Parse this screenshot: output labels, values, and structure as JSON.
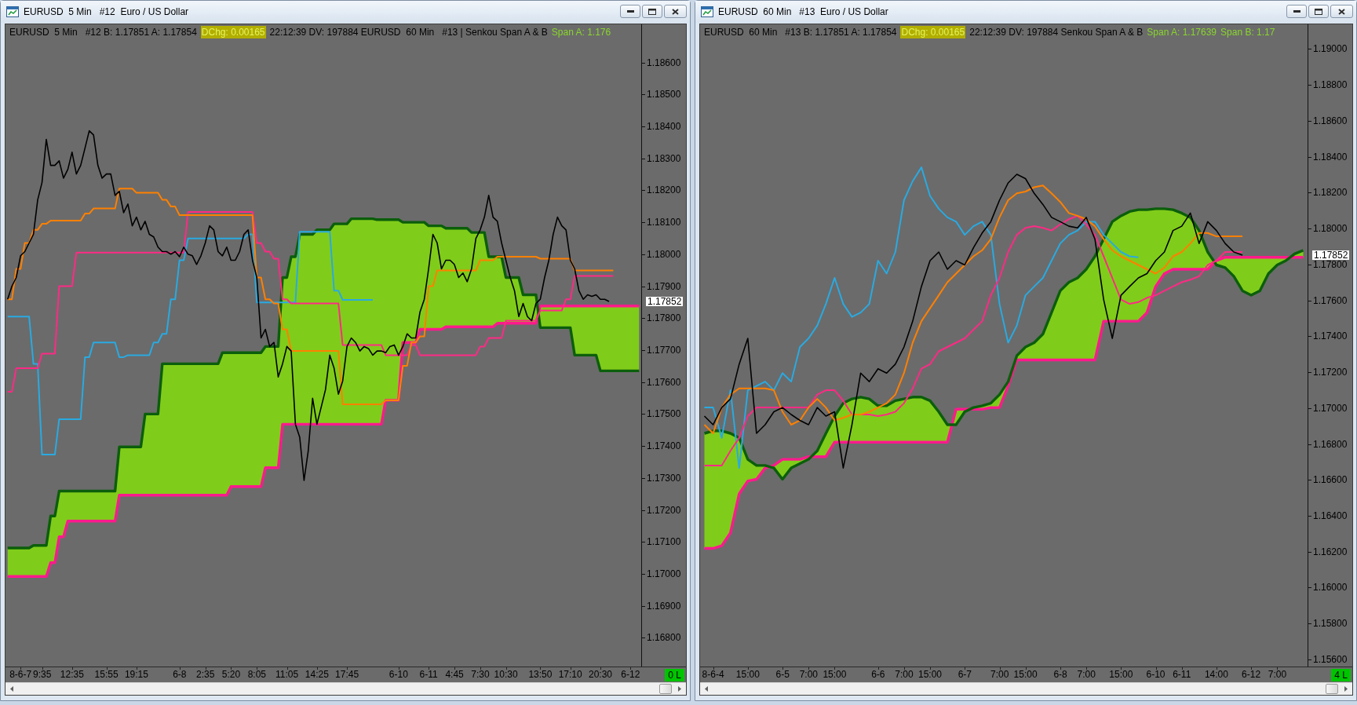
{
  "windows": [
    {
      "title": "EURUSD  5 Min   #12  Euro / US Dollar",
      "header": [
        {
          "kind": "text",
          "text": "EURUSD  5 Min   #12 B: 1.17851 A: 1.17854"
        },
        {
          "kind": "change",
          "text": "DChg: 0.00165"
        },
        {
          "kind": "text",
          "text": "22:12:39 DV: 197884 EURUSD  60 Min   #13 | Senkou Span A & B"
        },
        {
          "kind": "study-value",
          "text": "Span A: 1.176"
        }
      ],
      "bar_status": "0 L",
      "chart_data": {
        "type": "line",
        "categories": [
          null,
          null,
          null,
          "8-6-7",
          null,
          null,
          null,
          null,
          "9:35",
          null,
          null,
          null,
          null,
          null,
          null,
          "12:35",
          null,
          null,
          null,
          null,
          null,
          null,
          null,
          "15:55",
          null,
          null,
          null,
          null,
          null,
          null,
          "19:15",
          null,
          null,
          null,
          null,
          null,
          null,
          null,
          null,
          null,
          "6-8",
          null,
          null,
          null,
          null,
          null,
          "2:35",
          null,
          null,
          null,
          null,
          null,
          "5:20",
          null,
          null,
          null,
          null,
          null,
          "8:05",
          null,
          null,
          null,
          null,
          null,
          null,
          "11:05",
          null,
          null,
          null,
          null,
          null,
          null,
          "14:25",
          null,
          null,
          null,
          null,
          null,
          null,
          "17:45",
          null,
          null,
          null,
          null,
          null,
          null,
          null,
          null,
          null,
          null,
          null,
          "6-10",
          null,
          null,
          null,
          null,
          null,
          null,
          "6-11",
          null,
          null,
          null,
          null,
          null,
          "4:45",
          null,
          null,
          null,
          null,
          null,
          "7:30",
          null,
          null,
          null,
          null,
          null,
          "10:30",
          null,
          null,
          null,
          null,
          null,
          null,
          null,
          "13:50",
          null,
          null,
          null,
          null,
          null,
          null,
          "17:10",
          null,
          null,
          null,
          null,
          null,
          null,
          "20:30",
          null,
          null,
          null,
          null,
          null,
          null,
          "6-12",
          null,
          null
        ],
        "ylim": [
          1.1671,
          1.1867
        ],
        "yticks": [
          {
            "value": 1.186,
            "label": "1.18600"
          },
          {
            "value": 1.185,
            "label": "1.18500"
          },
          {
            "value": 1.184,
            "label": "1.18400"
          },
          {
            "value": 1.183,
            "label": "1.18300"
          },
          {
            "value": 1.182,
            "label": "1.18200"
          },
          {
            "value": 1.181,
            "label": "1.18100"
          },
          {
            "value": 1.18,
            "label": "1.18000"
          },
          {
            "value": 1.179,
            "label": "1.17900"
          },
          {
            "value": 1.178,
            "label": "1.17800"
          },
          {
            "value": 1.177,
            "label": "1.17700"
          },
          {
            "value": 1.176,
            "label": "1.17600"
          },
          {
            "value": 1.175,
            "label": "1.17500"
          },
          {
            "value": 1.174,
            "label": "1.17400"
          },
          {
            "value": 1.173,
            "label": "1.17300"
          },
          {
            "value": 1.172,
            "label": "1.17200"
          },
          {
            "value": 1.171,
            "label": "1.17100"
          },
          {
            "value": 1.17,
            "label": "1.17000"
          },
          {
            "value": 1.169,
            "label": "1.16900"
          },
          {
            "value": 1.168,
            "label": "1.16800"
          }
        ],
        "annotations": [
          "1.17852"
        ],
        "series": [
          {
            "color": "#000000",
            "values": [
              1.17859,
              1.179,
              1.17927,
              1.17995,
              1.18008,
              1.18035,
              1.18062,
              1.1817,
              1.18224,
              1.18359,
              1.18278,
              1.18278,
              1.18292,
              1.18238,
              1.18265,
              1.18319,
              1.18251,
              1.18278,
              1.18332,
              1.18386,
              1.18373,
              1.18278,
              1.18238,
              1.18251,
              1.18251,
              1.18184,
              1.18197,
              1.1813,
              1.18157,
              1.18089,
              1.18116,
              1.18076,
              1.18103,
              1.18062,
              1.18054,
              1.18022,
              1.18008,
              1.18008,
              1.18,
              1.18008,
              1.17992,
              1.18022,
              1.18,
              1.17995,
              1.17968,
              1.17995,
              1.18035,
              1.18089,
              1.18076,
              1.18008,
              1.17995,
              1.18022,
              1.17981,
              1.17981,
              1.18008,
              1.18062,
              1.18076,
              1.17981,
              1.17927,
              1.17738,
              1.17765,
              1.17711,
              1.17724,
              1.17616,
              1.17657,
              1.17711,
              1.17697,
              1.17468,
              1.17427,
              1.17292,
              1.17386,
              1.17549,
              1.17468,
              1.17522,
              1.17576,
              1.17684,
              1.17643,
              1.17562,
              1.17603,
              1.17711,
              1.17738,
              1.17724,
              1.17697,
              1.17711,
              1.17705,
              1.17684,
              1.17697,
              1.17697,
              1.17692,
              1.17711,
              1.17716,
              1.17684,
              1.17711,
              1.17751,
              1.17738,
              1.17738,
              1.17819,
              1.17859,
              1.17954,
              1.18062,
              1.18035,
              1.17954,
              1.17981,
              1.17981,
              1.17968,
              1.17927,
              1.17941,
              1.17914,
              1.17954,
              1.18049,
              1.18076,
              1.18116,
              1.18184,
              1.18116,
              1.18103,
              1.18035,
              1.17981,
              1.17927,
              1.17886,
              1.17805,
              1.17846,
              1.17805,
              1.17792,
              1.17846,
              1.17859,
              1.17927,
              1.17981,
              1.18062,
              1.18116,
              1.18089,
              1.18076,
              1.17981,
              1.17954,
              1.17886,
              1.17859,
              1.17873,
              1.17868,
              1.17873,
              1.17859,
              1.17859,
              1.17852,
              null,
              null,
              null,
              null,
              null,
              null,
              null
            ]
          },
          {
            "color": "#ff8000",
            "values": [
              1.17859,
              1.17859,
              1.17954,
              1.17954,
              1.18035,
              1.18035,
              1.18076,
              1.18076,
              1.18095,
              1.18095,
              1.18105,
              1.18105,
              1.18105,
              1.18105,
              1.18105,
              1.18105,
              1.18105,
              1.18105,
              1.18127,
              1.18127,
              1.18143,
              1.18143,
              1.18143,
              1.18143,
              1.18143,
              1.18143,
              1.18205,
              1.18205,
              1.18205,
              1.18205,
              1.18192,
              1.18192,
              1.18192,
              1.18192,
              1.18192,
              1.18192,
              1.1817,
              1.1817,
              1.18149,
              1.18149,
              1.18122,
              1.18122,
              1.18122,
              1.18122,
              1.18122,
              1.18122,
              1.18122,
              1.18122,
              1.18122,
              1.18122,
              1.18122,
              1.18122,
              1.18122,
              1.18122,
              1.18122,
              1.18122,
              1.18122,
              1.18122,
              1.17927,
              1.17927,
              1.17859,
              1.17859,
              1.17846,
              1.17846,
              1.17765,
              1.17765,
              1.17697,
              1.17697,
              1.17697,
              1.17697,
              1.17697,
              1.17697,
              1.17697,
              1.17697,
              1.17697,
              1.17697,
              1.17697,
              1.17697,
              1.1753,
              1.1753,
              1.1753,
              1.1753,
              1.1753,
              1.1753,
              1.1753,
              1.1753,
              1.1753,
              1.1753,
              1.17543,
              1.17543,
              1.17543,
              1.17543,
              1.17651,
              1.17651,
              1.17724,
              1.17724,
              1.17743,
              1.17743,
              1.179,
              1.179,
              1.17949,
              1.17949,
              1.17949,
              1.17949,
              1.17949,
              1.17949,
              1.17949,
              1.17949,
              1.17949,
              1.17949,
              1.17981,
              1.17981,
              1.17981,
              1.17981,
              1.17992,
              1.17992,
              1.17992,
              1.17992,
              1.17992,
              1.17992,
              1.17992,
              1.17992,
              1.17992,
              1.17992,
              1.17986,
              1.17986,
              1.17986,
              1.17986,
              1.17986,
              1.17986,
              1.17986,
              1.17986,
              1.17949,
              1.17949,
              1.17949,
              1.17949,
              1.17949,
              1.17949,
              1.17949,
              1.17949,
              1.17949,
              1.17949,
              null,
              null,
              null,
              null,
              null,
              null
            ]
          },
          {
            "color": "#ff2a85",
            "values": [
              1.1757,
              1.1757,
              1.17643,
              1.17643,
              1.17643,
              1.17643,
              1.17643,
              1.17643,
              1.17689,
              1.17689,
              1.17689,
              1.17689,
              1.179,
              1.179,
              1.179,
              1.179,
              1.18005,
              1.18005,
              1.18005,
              1.18005,
              1.18005,
              1.18005,
              1.18005,
              1.18005,
              1.18005,
              1.18005,
              1.18005,
              1.18005,
              1.18005,
              1.18005,
              1.18005,
              1.18005,
              1.18005,
              1.18005,
              1.18005,
              1.18005,
              1.18005,
              1.18005,
              1.18005,
              1.18005,
              1.18005,
              1.18005,
              1.18132,
              1.18132,
              1.18132,
              1.18132,
              1.18132,
              1.18132,
              1.18132,
              1.18132,
              1.18132,
              1.18132,
              1.18132,
              1.18132,
              1.18132,
              1.18132,
              1.18132,
              1.18132,
              1.18035,
              1.18035,
              1.18008,
              1.18008,
              1.17986,
              1.17986,
              1.17859,
              1.17859,
              1.17846,
              1.17846,
              1.17846,
              1.17846,
              1.17846,
              1.17846,
              1.17846,
              1.17846,
              1.17846,
              1.17846,
              1.17846,
              1.17846,
              1.17716,
              1.17716,
              1.17716,
              1.17716,
              1.17716,
              1.17716,
              1.17716,
              1.17716,
              1.17716,
              1.17716,
              1.17684,
              1.17684,
              1.17684,
              1.17684,
              1.17684,
              1.17684,
              1.17716,
              1.17716,
              1.17684,
              1.17684,
              1.17684,
              1.17684,
              1.17684,
              1.17684,
              1.17684,
              1.17684,
              1.17684,
              1.17684,
              1.17684,
              1.17684,
              1.17684,
              1.17684,
              1.17711,
              1.17711,
              1.17738,
              1.17738,
              1.17738,
              1.17738,
              1.17792,
              1.17792,
              1.17792,
              1.17792,
              1.17792,
              1.17792,
              1.17792,
              1.17792,
              1.17824,
              1.17824,
              1.17824,
              1.17824,
              1.17824,
              1.17824,
              1.17859,
              1.17859,
              1.17932,
              1.17932,
              1.17932,
              1.17932,
              1.17932,
              1.17932,
              1.17932,
              1.17932,
              1.17932,
              1.17932,
              null,
              null,
              null,
              null,
              null,
              null
            ]
          },
          {
            "color": "#29aae1",
            "values": [
              1.17805,
              1.17805,
              1.17805,
              1.17805,
              1.17805,
              1.17805,
              1.17657,
              1.17657,
              1.17373,
              1.17373,
              1.17373,
              1.17373,
              1.17484,
              1.17484,
              1.17484,
              1.17484,
              1.17484,
              1.17484,
              1.17678,
              1.17678,
              1.17724,
              1.17724,
              1.17724,
              1.17724,
              1.17724,
              1.17724,
              1.17678,
              1.17678,
              1.17684,
              1.17684,
              1.17684,
              1.17684,
              1.17684,
              1.17684,
              1.17724,
              1.17724,
              1.17751,
              1.17751,
              1.17859,
              1.17859,
              1.17981,
              1.17981,
              1.18049,
              1.18049,
              1.18049,
              1.18049,
              1.18049,
              1.18049,
              1.18049,
              1.18049,
              1.18049,
              1.18049,
              1.18049,
              1.18049,
              1.18049,
              1.18049,
              1.18062,
              1.18062,
              1.17849,
              1.17849,
              1.17849,
              1.17849,
              1.17849,
              1.17849,
              1.17849,
              1.17849,
              1.17849,
              1.17849,
              1.1807,
              1.1807,
              1.1807,
              1.1807,
              1.1807,
              1.1807,
              1.1807,
              1.1807,
              1.17886,
              1.17886,
              1.17857,
              1.17857,
              1.17857,
              1.17857,
              1.17857,
              1.17857,
              1.17857,
              1.17857,
              null,
              null,
              null,
              null,
              null,
              null,
              null,
              null,
              null,
              null,
              null,
              null,
              null,
              null,
              null,
              null,
              null,
              null,
              null,
              null,
              null,
              null,
              null,
              null,
              null,
              null,
              null,
              null,
              null,
              null,
              null,
              null,
              null,
              null,
              null,
              null,
              null,
              null,
              null,
              null,
              null,
              null,
              null,
              null,
              null,
              null,
              null,
              null,
              null,
              null,
              null,
              null,
              null,
              null,
              null,
              null,
              null,
              null,
              null,
              null,
              null,
              null
            ]
          },
          {
            "color": "#0b5e0b",
            "values": [
              1.17081,
              1.17081,
              1.17081,
              1.17081,
              1.17081,
              1.17081,
              1.17089,
              1.17089,
              1.17089,
              1.17089,
              1.17181,
              1.17181,
              1.17259,
              1.17259,
              1.17259,
              1.17259,
              1.17259,
              1.17259,
              1.17259,
              1.17259,
              1.17259,
              1.17259,
              1.17259,
              1.17259,
              1.17259,
              1.17259,
              1.17397,
              1.17397,
              1.17397,
              1.17397,
              1.17397,
              1.17397,
              1.175,
              1.175,
              1.175,
              1.175,
              1.17657,
              1.17657,
              1.17657,
              1.17657,
              1.17657,
              1.17657,
              1.17657,
              1.17657,
              1.17657,
              1.17657,
              1.17657,
              1.17657,
              1.17657,
              1.17657,
              1.17692,
              1.17692,
              1.17692,
              1.17692,
              1.17692,
              1.17692,
              1.17692,
              1.17692,
              1.17692,
              1.17692,
              1.17711,
              1.17711,
              1.17711,
              1.17711,
              1.17927,
              1.17927,
              1.17992,
              1.17992,
              1.18062,
              1.18062,
              1.18062,
              1.18062,
              1.18076,
              1.18076,
              1.18076,
              1.18076,
              1.18095,
              1.18095,
              1.18095,
              1.18095,
              1.18111,
              1.18111,
              1.18111,
              1.18111,
              1.18111,
              1.18111,
              1.18108,
              1.18108,
              1.18108,
              1.18108,
              1.18108,
              1.18108,
              1.181,
              1.181,
              1.181,
              1.181,
              1.181,
              1.181,
              1.18089,
              1.18089,
              1.18089,
              1.18089,
              1.18081,
              1.18081,
              1.18081,
              1.18081,
              1.18081,
              1.18081,
              1.18068,
              1.18068,
              1.18068,
              1.18068,
              1.17992,
              1.17992,
              1.17992,
              1.17992,
              1.17927,
              1.17927,
              1.17927,
              1.17927,
              1.17873,
              1.17873,
              1.17873,
              1.17873,
              1.1777,
              1.1777,
              1.1777,
              1.1777,
              1.1777,
              1.1777,
              1.1777,
              1.1777,
              1.17684,
              1.17684,
              1.17684,
              1.17684,
              1.17684,
              1.17684,
              1.17635,
              1.17635,
              1.17635,
              1.17635,
              1.17635,
              1.17635,
              1.17635,
              1.17635,
              1.17635,
              1.17635
            ]
          },
          {
            "color": "#ff1a8c",
            "values": [
              1.16992,
              1.16992,
              1.16992,
              1.16992,
              1.16992,
              1.16992,
              1.16992,
              1.16992,
              1.16992,
              1.16992,
              1.17035,
              1.17035,
              1.17116,
              1.17116,
              1.17165,
              1.17165,
              1.17165,
              1.17165,
              1.17165,
              1.17165,
              1.17165,
              1.17165,
              1.17165,
              1.17165,
              1.17165,
              1.17165,
              1.17246,
              1.17246,
              1.17246,
              1.17246,
              1.17246,
              1.17246,
              1.17246,
              1.17246,
              1.17246,
              1.17246,
              1.17246,
              1.17246,
              1.17246,
              1.17246,
              1.17246,
              1.17246,
              1.17246,
              1.17246,
              1.17246,
              1.17246,
              1.17246,
              1.17246,
              1.17246,
              1.17246,
              1.17246,
              1.17246,
              1.17273,
              1.17273,
              1.17273,
              1.17273,
              1.17273,
              1.17273,
              1.17273,
              1.17273,
              1.17332,
              1.17332,
              1.17332,
              1.17332,
              1.17468,
              1.17468,
              1.17468,
              1.17468,
              1.17468,
              1.17468,
              1.17468,
              1.17468,
              1.17468,
              1.17468,
              1.17468,
              1.17468,
              1.17468,
              1.17468,
              1.17468,
              1.17468,
              1.17468,
              1.17468,
              1.17468,
              1.17468,
              1.17468,
              1.17468,
              1.17468,
              1.17468,
              1.17543,
              1.17543,
              1.17543,
              1.17543,
              1.17724,
              1.17724,
              1.17724,
              1.17724,
              1.17765,
              1.17765,
              1.17765,
              1.17765,
              1.17765,
              1.17765,
              1.17773,
              1.17773,
              1.17773,
              1.17773,
              1.17773,
              1.17773,
              1.17773,
              1.17773,
              1.17773,
              1.17773,
              1.17773,
              1.17773,
              1.17784,
              1.17784,
              1.17784,
              1.17784,
              1.17784,
              1.17784,
              1.17784,
              1.17784,
              1.17784,
              1.17784,
              1.17838,
              1.17838,
              1.17838,
              1.17838,
              1.17838,
              1.17838,
              1.17838,
              1.17838,
              1.17838,
              1.17838,
              1.17838,
              1.17838,
              1.17838,
              1.17838,
              1.17838,
              1.17838,
              1.17838,
              1.17838,
              1.17838,
              1.17838,
              1.17838,
              1.17838,
              1.17838,
              1.17838
            ]
          }
        ]
      }
    },
    {
      "title": "EURUSD  60 Min   #13  Euro / US Dollar",
      "header": [
        {
          "kind": "text",
          "text": "EURUSD  60 Min   #13 B: 1.17851 A: 1.17854"
        },
        {
          "kind": "change",
          "text": "DChg: 0.00165"
        },
        {
          "kind": "text",
          "text": "22:12:39 DV: 197884 Senkou Span A & B"
        },
        {
          "kind": "study-value",
          "text": "Span A: 1.17639"
        },
        {
          "kind": "study-value",
          "text": "Span B: 1.17"
        }
      ],
      "bar_status": "4 L",
      "chart_data": {
        "type": "line",
        "categories": [
          null,
          "8-6-4",
          null,
          null,
          null,
          "15:00",
          null,
          null,
          null,
          "6-5",
          null,
          null,
          "7:00",
          null,
          null,
          "15:00",
          null,
          null,
          null,
          null,
          "6-6",
          null,
          null,
          "7:00",
          null,
          null,
          "15:00",
          null,
          null,
          null,
          "6-7",
          null,
          null,
          null,
          "7:00",
          null,
          null,
          "15:00",
          null,
          null,
          null,
          "6-8",
          null,
          null,
          "7:00",
          null,
          null,
          null,
          "15:00",
          null,
          null,
          null,
          "6-10",
          null,
          null,
          "6-11",
          null,
          null,
          null,
          "14:00",
          null,
          null,
          null,
          "6-12",
          null,
          null,
          "7:00",
          null,
          null,
          null
        ],
        "ylim": [
          1.1556,
          1.1905
        ],
        "yticks": [
          {
            "value": 1.19,
            "label": "1.19000"
          },
          {
            "value": 1.188,
            "label": "1.18800"
          },
          {
            "value": 1.186,
            "label": "1.18600"
          },
          {
            "value": 1.184,
            "label": "1.18400"
          },
          {
            "value": 1.182,
            "label": "1.18200"
          },
          {
            "value": 1.18,
            "label": "1.18000"
          },
          {
            "value": 1.178,
            "label": "1.17800"
          },
          {
            "value": 1.176,
            "label": "1.17600"
          },
          {
            "value": 1.174,
            "label": "1.17400"
          },
          {
            "value": 1.172,
            "label": "1.17200"
          },
          {
            "value": 1.17,
            "label": "1.17000"
          },
          {
            "value": 1.168,
            "label": "1.16800"
          },
          {
            "value": 1.166,
            "label": "1.16600"
          },
          {
            "value": 1.164,
            "label": "1.16400"
          },
          {
            "value": 1.162,
            "label": "1.16200"
          },
          {
            "value": 1.16,
            "label": "1.16000"
          },
          {
            "value": 1.158,
            "label": "1.15800"
          },
          {
            "value": 1.156,
            "label": "1.15600"
          }
        ],
        "annotations": [
          "1.17852"
        ],
        "series": [
          {
            "color": "#000000",
            "values": [
              1.16955,
              1.16907,
              1.17003,
              1.17051,
              1.17244,
              1.17388,
              1.16859,
              1.16907,
              1.16979,
              1.17003,
              1.16964,
              1.16931,
              1.16907,
              1.17003,
              1.16955,
              1.16979,
              1.16666,
              1.16907,
              1.17195,
              1.17147,
              1.17219,
              1.17195,
              1.17244,
              1.1734,
              1.17484,
              1.17677,
              1.17821,
              1.17869,
              1.17773,
              1.17821,
              1.17797,
              1.17893,
              1.17975,
              1.18038,
              1.18158,
              1.18254,
              1.18302,
              1.18278,
              1.18196,
              1.18134,
              1.18062,
              1.18038,
              1.18013,
              1.18004,
              1.18062,
              1.17941,
              1.17604,
              1.17388,
              1.17628,
              1.17677,
              1.17725,
              1.17749,
              1.17821,
              1.17869,
              1.17989,
              1.18013,
              1.18086,
              1.17917,
              1.18038,
              1.17989,
              1.17917,
              1.17869,
              1.17852,
              null,
              null,
              null,
              null,
              null,
              null,
              null
            ]
          },
          {
            "color": "#ff8000",
            "values": [
              1.16907,
              1.16859,
              1.17003,
              1.17075,
              1.17109,
              1.17109,
              1.17109,
              1.17109,
              1.17099,
              1.16979,
              1.16907,
              1.16931,
              1.17003,
              1.17051,
              1.17003,
              1.16931,
              1.16945,
              1.16964,
              1.16964,
              1.16979,
              1.17003,
              1.17027,
              1.17075,
              1.17195,
              1.17364,
              1.17484,
              1.17556,
              1.17628,
              1.17701,
              1.17749,
              1.17797,
              1.17845,
              1.17879,
              1.17941,
              1.18062,
              1.18158,
              1.18196,
              1.18206,
              1.1823,
              1.1824,
              1.18196,
              1.18148,
              1.18086,
              1.18071,
              1.18052,
              1.18013,
              1.17941,
              1.17879,
              1.17845,
              1.17821,
              1.17797,
              1.17773,
              1.17749,
              1.17782,
              1.17845,
              1.17869,
              1.17917,
              1.17975,
              1.17975,
              1.17956,
              1.17956,
              1.17956,
              1.17956,
              null,
              null,
              null,
              null,
              null,
              null,
              null
            ]
          },
          {
            "color": "#ff2a85",
            "values": [
              1.1668,
              1.1668,
              1.1668,
              1.16762,
              1.16834,
              1.16955,
              1.17003,
              1.17003,
              1.17003,
              1.17003,
              1.17003,
              1.17003,
              1.17003,
              1.17075,
              1.17099,
              1.17099,
              1.17041,
              1.16964,
              1.16964,
              1.16964,
              1.16955,
              1.16964,
              1.16979,
              1.17027,
              1.17109,
              1.17219,
              1.17244,
              1.17316,
              1.1734,
              1.17364,
              1.17388,
              1.17436,
              1.17484,
              1.17628,
              1.17725,
              1.17869,
              1.17965,
              1.18004,
              1.18013,
              1.18004,
              1.17989,
              1.18023,
              1.18052,
              1.18071,
              1.18023,
              1.17965,
              1.17845,
              1.17725,
              1.17604,
              1.1758,
              1.1759,
              1.17614,
              1.17628,
              1.17653,
              1.17677,
              1.17701,
              1.17715,
              1.17734,
              1.17797,
              1.17821,
              1.17869,
              1.17869,
              1.17869,
              null,
              null,
              null,
              null,
              null,
              null,
              null
            ]
          },
          {
            "color": "#29aae1",
            "values": [
              1.17003,
              1.17003,
              1.16834,
              1.17099,
              1.16666,
              1.17099,
              1.17123,
              1.17147,
              1.17099,
              1.17195,
              1.17147,
              1.1734,
              1.17388,
              1.1746,
              1.1758,
              1.17725,
              1.1758,
              1.17508,
              1.17532,
              1.1758,
              1.17821,
              1.17749,
              1.17869,
              1.18158,
              1.18264,
              1.18341,
              1.18182,
              1.1811,
              1.18062,
              1.18038,
              1.17965,
              1.18013,
              1.18038,
              1.17965,
              1.1758,
              1.17364,
              1.1746,
              1.17628,
              1.17677,
              1.17725,
              1.17821,
              1.17917,
              1.17965,
              1.17989,
              1.18038,
              1.18038,
              1.17965,
              1.17917,
              1.17869,
              1.17845,
              1.1784,
              null,
              null,
              null,
              null,
              null,
              null,
              null,
              null,
              null,
              null,
              null,
              null,
              null,
              null,
              null,
              null,
              null,
              null,
              null
            ]
          },
          {
            "color": "#0b5e0b",
            "values": [
              1.16859,
              1.16873,
              1.16873,
              1.16859,
              1.16834,
              1.16714,
              1.1668,
              1.1668,
              1.16666,
              1.16603,
              1.16666,
              1.1669,
              1.16714,
              1.16762,
              1.16859,
              1.16955,
              1.17027,
              1.17051,
              1.17061,
              1.17051,
              1.17013,
              1.17013,
              1.17041,
              1.17051,
              1.17061,
              1.17061,
              1.17041,
              1.16979,
              1.16907,
              1.16907,
              1.16979,
              1.17003,
              1.17013,
              1.17027,
              1.17075,
              1.17147,
              1.17292,
              1.1734,
              1.17364,
              1.17412,
              1.17532,
              1.17653,
              1.17701,
              1.17725,
              1.17773,
              1.17845,
              1.17941,
              1.18038,
              1.18071,
              1.18095,
              1.18105,
              1.18105,
              1.1811,
              1.1811,
              1.18105,
              1.18086,
              1.18062,
              1.17989,
              1.17869,
              1.17797,
              1.17782,
              1.17734,
              1.17653,
              1.17628,
              1.17653,
              1.17749,
              1.17797,
              1.17821,
              1.17859,
              1.17879
            ]
          },
          {
            "color": "#ff1a8c",
            "values": [
              1.16218,
              1.16218,
              1.16233,
              1.16305,
              1.16522,
              1.16594,
              1.16603,
              1.16666,
              1.1668,
              1.16714,
              1.16714,
              1.16714,
              1.16729,
              1.16729,
              1.16729,
              1.1681,
              1.1681,
              1.1681,
              1.1681,
              1.1681,
              1.1681,
              1.1681,
              1.1681,
              1.1681,
              1.1681,
              1.1681,
              1.1681,
              1.1681,
              1.1681,
              1.16993,
              1.16993,
              1.16993,
              1.16993,
              1.17003,
              1.17003,
              1.17123,
              1.17268,
              1.17268,
              1.17268,
              1.17268,
              1.17268,
              1.17268,
              1.17268,
              1.17268,
              1.17268,
              1.17268,
              1.17484,
              1.17484,
              1.17484,
              1.17484,
              1.17484,
              1.17532,
              1.17677,
              1.17749,
              1.17773,
              1.17773,
              1.17773,
              1.17773,
              1.17773,
              1.17821,
              1.1784,
              1.1784,
              1.1784,
              1.1784,
              1.1784,
              1.1784,
              1.1784,
              1.1784,
              1.1784,
              1.1784
            ]
          }
        ]
      }
    }
  ]
}
